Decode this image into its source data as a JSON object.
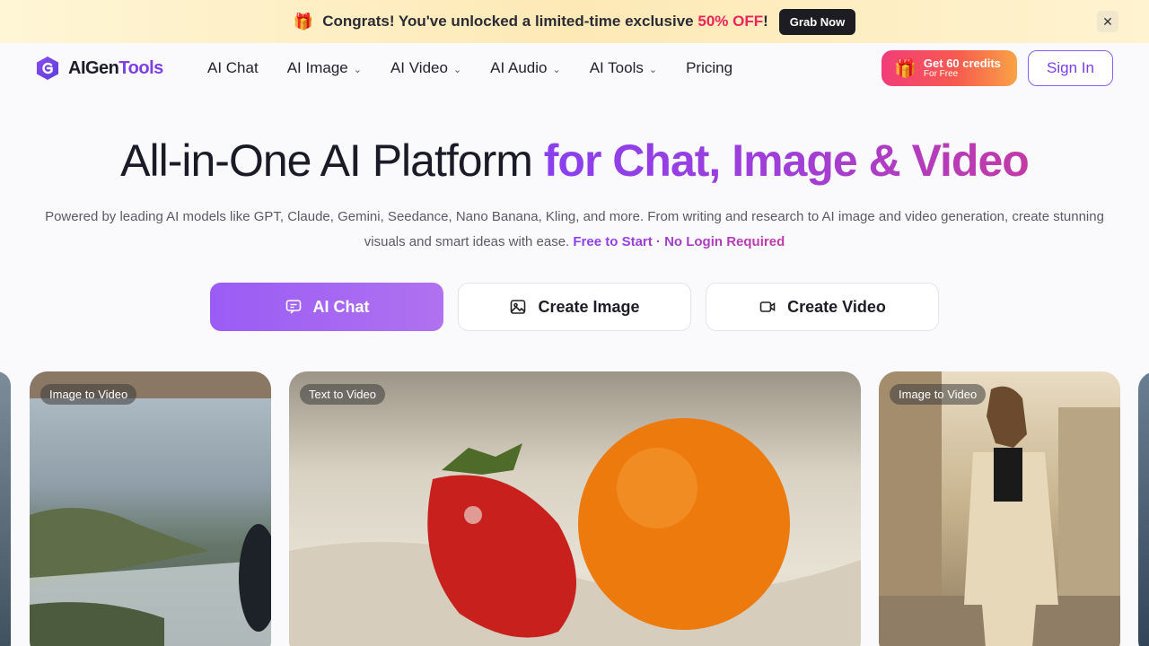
{
  "promo": {
    "gift_icon": "🎁",
    "text_before": "Congrats! You've unlocked a limited-time exclusive ",
    "highlight": "50% OFF",
    "text_after": "!",
    "button": "Grab Now",
    "close_icon": "✕"
  },
  "nav": {
    "logo_text_main": "AIGen",
    "logo_text_accent": "Tools",
    "items": [
      {
        "label": "AI Chat",
        "has_dropdown": false
      },
      {
        "label": "AI Image",
        "has_dropdown": true
      },
      {
        "label": "AI Video",
        "has_dropdown": true
      },
      {
        "label": "AI Audio",
        "has_dropdown": true
      },
      {
        "label": "AI Tools",
        "has_dropdown": true
      },
      {
        "label": "Pricing",
        "has_dropdown": false
      }
    ],
    "credits_main": "Get 60 credits",
    "credits_sub": "For Free",
    "sign_in": "Sign In"
  },
  "hero": {
    "title_plain": "All-in-One AI Platform ",
    "title_accent": "for Chat, Image & Video",
    "subtitle": "Powered by leading AI models like GPT, Claude, Gemini, Seedance, Nano Banana, Kling, and more. From writing and research to AI image and video generation, create stunning visuals and smart ideas with ease. ",
    "subtitle_accent": "Free to Start · No Login Required"
  },
  "cta": {
    "chat": "AI Chat",
    "image": "Create Image",
    "video": "Create Video"
  },
  "cards": [
    {
      "tag": "Image to Video"
    },
    {
      "tag": "Text to Video"
    },
    {
      "tag": "Image to Video"
    }
  ],
  "colors": {
    "accent": "#7b3fe4",
    "promo_highlight": "#f0245a"
  }
}
